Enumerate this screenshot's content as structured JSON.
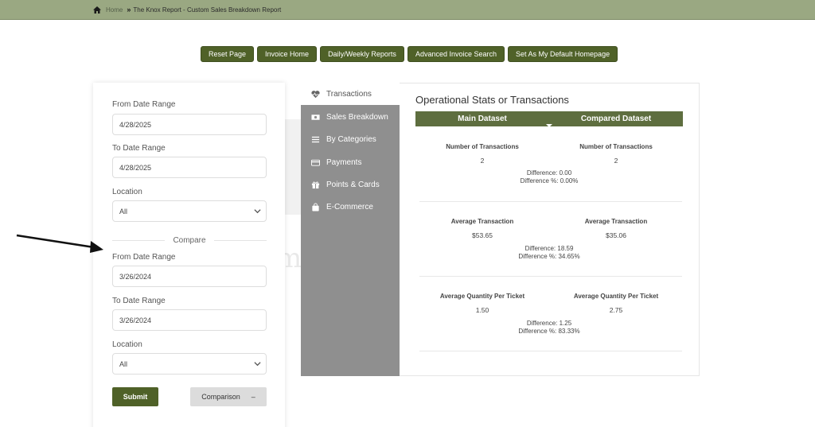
{
  "breadcrumb": {
    "home": "Home",
    "current": "The Knox Report - Custom Sales Breakdown Report"
  },
  "top_buttons": [
    "Reset Page",
    "Invoice Home",
    "Daily/Weekly Reports",
    "Advanced Invoice Search",
    "Set As My Default Homepage"
  ],
  "filters": {
    "from_label": "From Date Range",
    "from_value": "4/28/2025",
    "to_label": "To Date Range",
    "to_value": "4/28/2025",
    "location_label": "Location",
    "location_value": "All",
    "compare_label": "Compare",
    "cmp_from_label": "From Date Range",
    "cmp_from_value": "3/26/2024",
    "cmp_to_label": "To Date Range",
    "cmp_to_value": "3/26/2024",
    "cmp_location_label": "Location",
    "cmp_location_value": "All",
    "submit": "Submit",
    "comparison": "Comparison",
    "comparison_symbol": "–"
  },
  "nav": [
    "Transactions",
    "Sales Breakdown",
    "By Categories",
    "Payments",
    "Points & Cards",
    "E-Commerce"
  ],
  "stats": {
    "title": "Operational Stats or Transactions",
    "main_tab": "Main Dataset",
    "compared_tab": "Compared Dataset",
    "rows": [
      {
        "label": "Number of Transactions",
        "main": "2",
        "compared": "2",
        "difference": "Difference: 0.00",
        "difference_pct": "Difference %: 0.00%"
      },
      {
        "label": "Average Transaction",
        "main": "$53.65",
        "compared": "$35.06",
        "difference": "Difference: 18.59",
        "difference_pct": "Difference %: 34.65%"
      },
      {
        "label": "Average Quantity Per Ticket",
        "main": "1.50",
        "compared": "2.75",
        "difference": "Difference: 1.25",
        "difference_pct": "Difference %: 83.33%"
      }
    ]
  },
  "colors": {
    "accent": "#4f6128",
    "header_bar": "#9aa882",
    "sidenav": "#8f8f8f"
  }
}
